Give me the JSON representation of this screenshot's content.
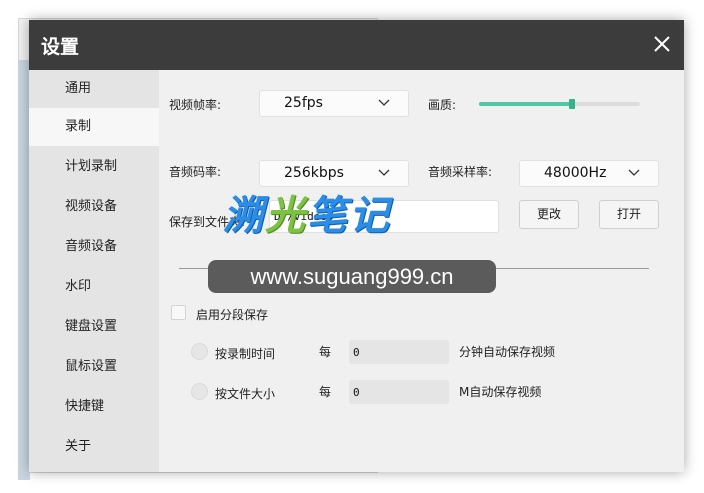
{
  "dialog": {
    "title": "设置"
  },
  "sidebar": {
    "items": [
      {
        "label": "通用"
      },
      {
        "label": "录制"
      },
      {
        "label": "计划录制"
      },
      {
        "label": "视频设备"
      },
      {
        "label": "音频设备"
      },
      {
        "label": "水印"
      },
      {
        "label": "键盘设置"
      },
      {
        "label": "鼠标设置"
      },
      {
        "label": "快捷键"
      },
      {
        "label": "关于"
      }
    ],
    "active": "录制"
  },
  "settings": {
    "frame_rate_label": "视频帧率:",
    "frame_rate_value": "25fps",
    "quality_label": "画质:",
    "quality_level": 0.58,
    "audio_bitrate_label": "音频码率:",
    "audio_bitrate_value": "256kbps",
    "sample_rate_label": "音频采样率:",
    "sample_rate_value": "48000Hz",
    "save_folder_label": "保存到文件夹:",
    "save_folder_value": "D:/Videos",
    "change_button": "更改",
    "open_button": "打开",
    "segment_label": "启用分段保存",
    "by_time_label": "按录制时间",
    "every_label_1": "每",
    "time_value": "0",
    "time_suffix": "分钟自动保存视频",
    "by_size_label": "按文件大小",
    "every_label_2": "每",
    "size_value": "0",
    "size_suffix": "M自动保存视频"
  },
  "watermark": {
    "text_part1": "溯",
    "text_part2": "光",
    "text_part3": "笔记",
    "url": "www.suguang999.cn"
  },
  "colors": {
    "titlebar": "#3c3c3c",
    "accent": "#52c7a6"
  }
}
